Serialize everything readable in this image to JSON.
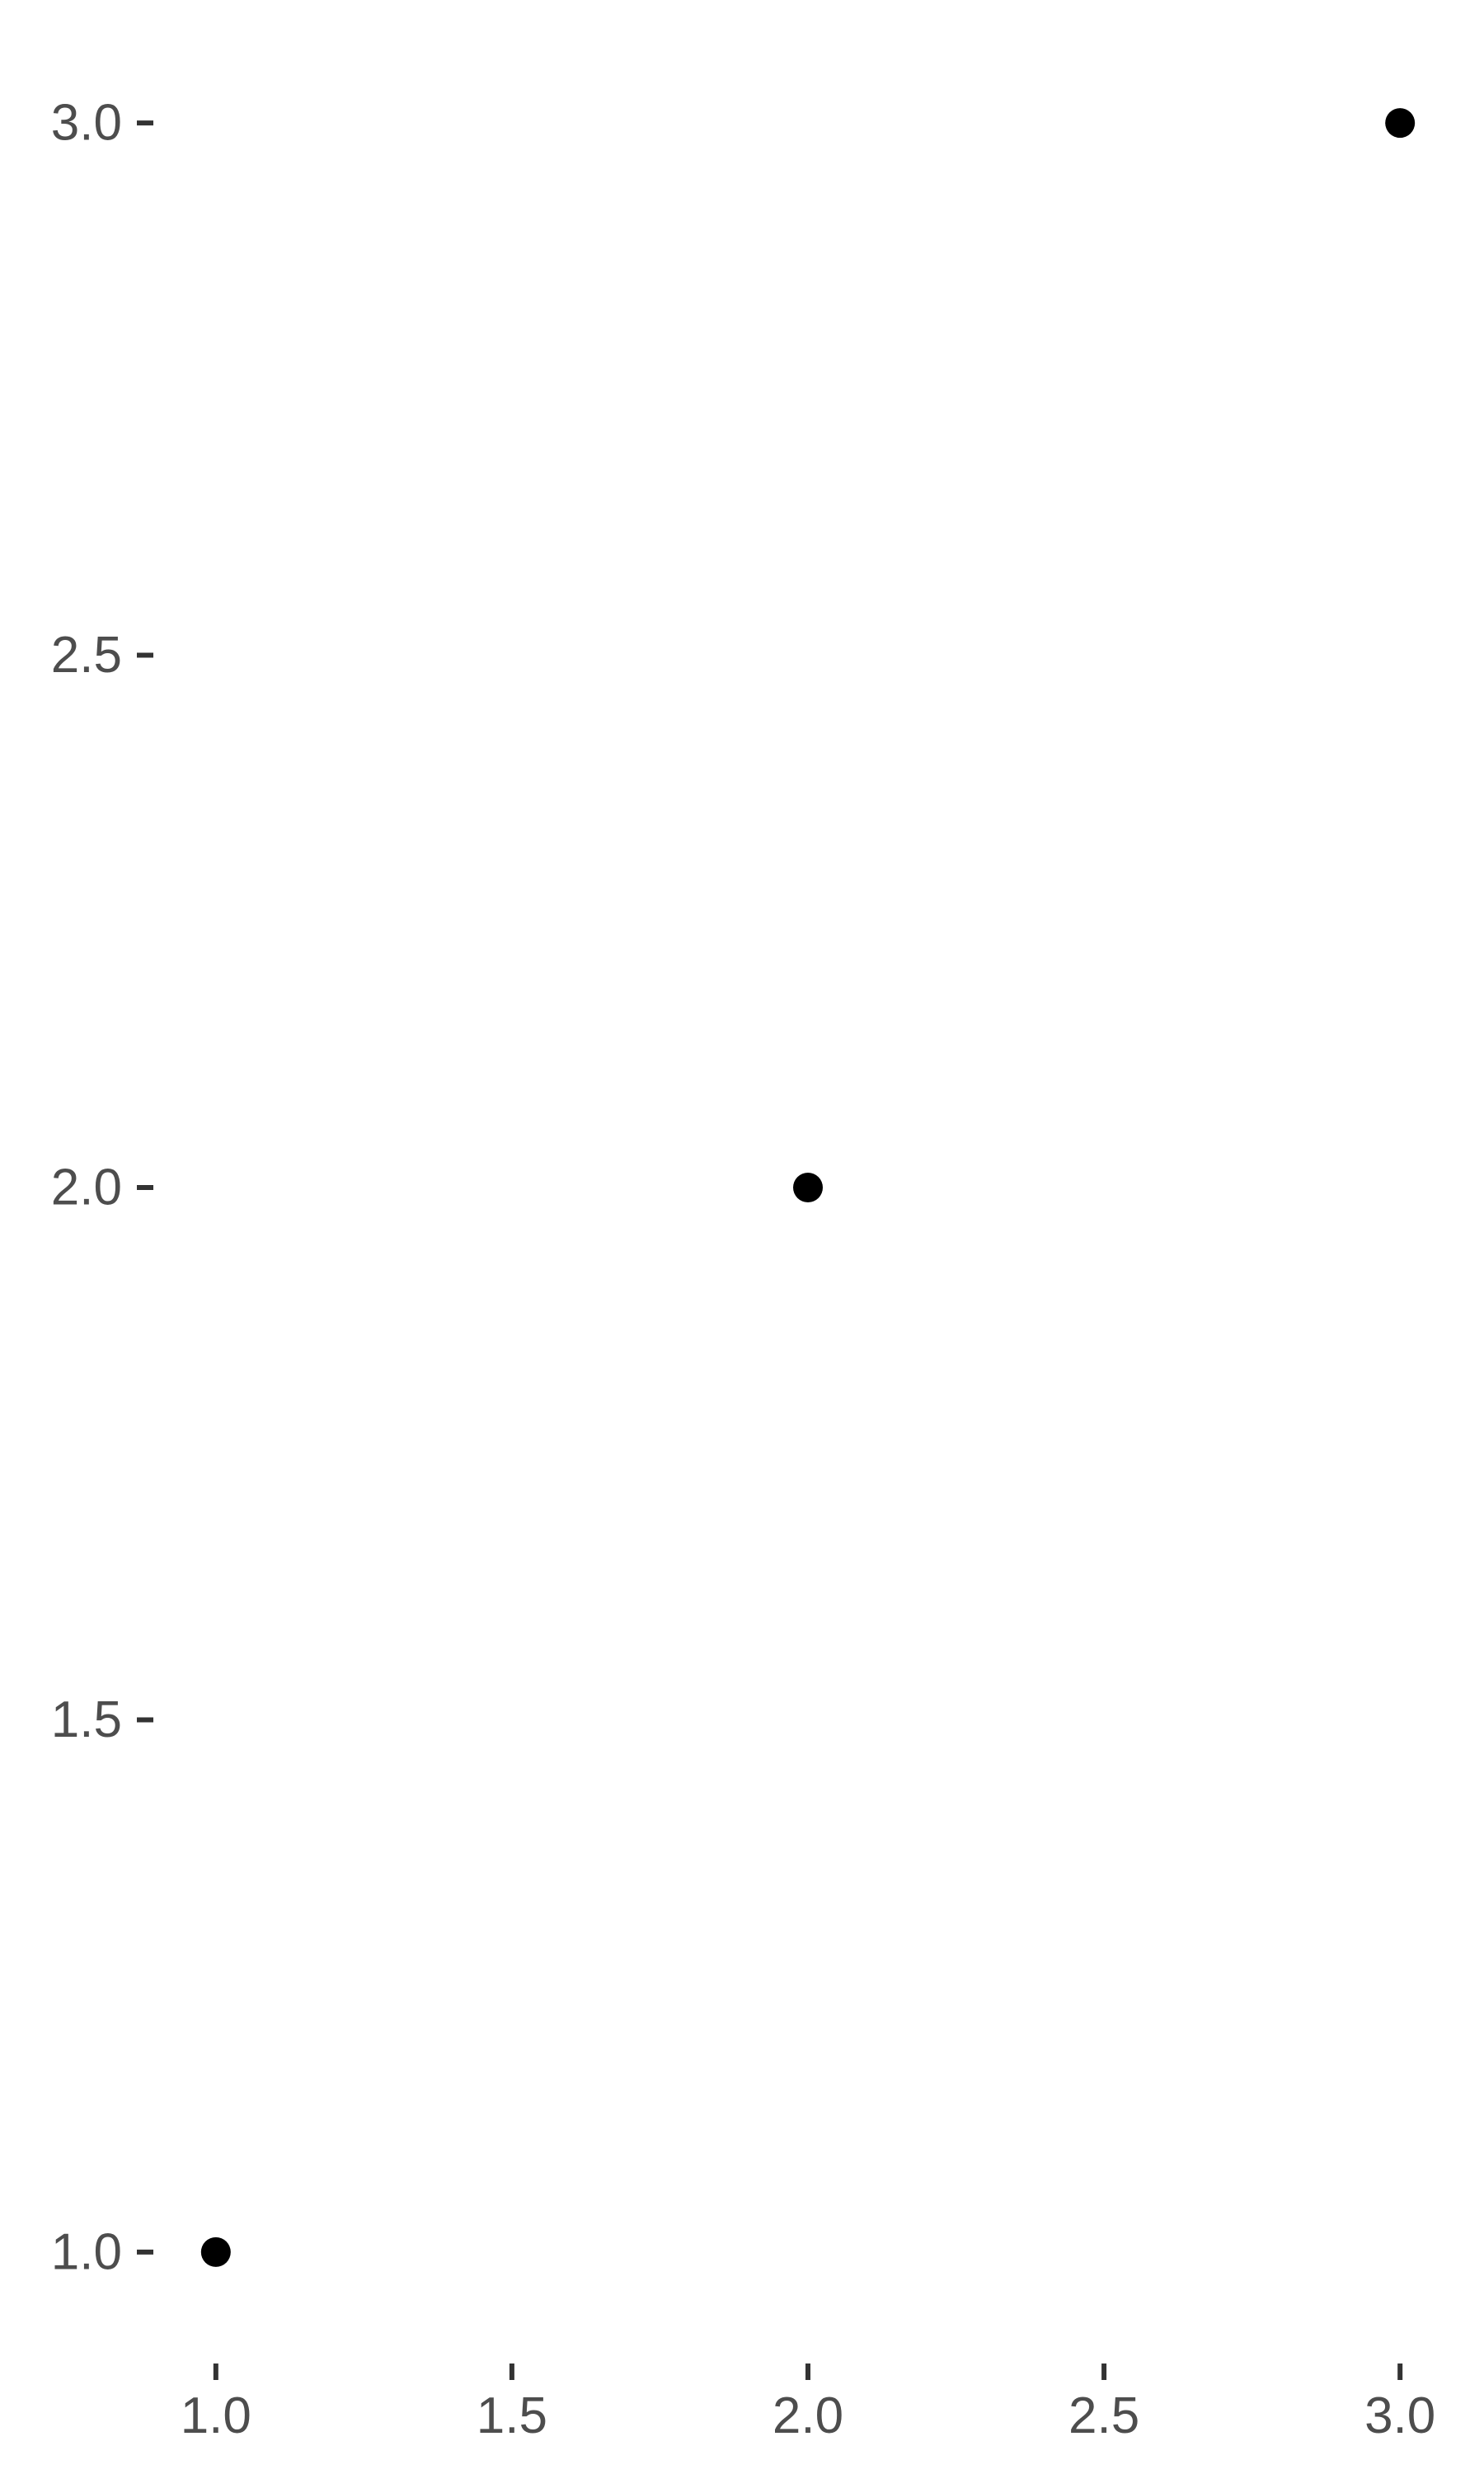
{
  "chart_data": {
    "type": "scatter",
    "title": "",
    "xlabel": "",
    "ylabel": "",
    "xlim": [
      0.9,
      3.1
    ],
    "ylim": [
      0.9,
      3.1
    ],
    "x_ticks": [
      1.0,
      1.5,
      2.0,
      2.5,
      3.0
    ],
    "y_ticks": [
      1.0,
      1.5,
      2.0,
      2.5,
      3.0
    ],
    "x_tick_labels": [
      "1.0",
      "1.5",
      "2.0",
      "2.5",
      "3.0"
    ],
    "y_tick_labels": [
      "1.0",
      "1.5",
      "2.0",
      "2.5",
      "3.0"
    ],
    "grid": false,
    "series": [
      {
        "x": [
          1,
          2,
          3
        ],
        "y": [
          1,
          2,
          3
        ],
        "color": "#000000"
      }
    ],
    "colors": {
      "background": "#ffffff",
      "tick_text": "#4d4d4d",
      "tick_mark": "#333333",
      "point": "#000000"
    }
  }
}
